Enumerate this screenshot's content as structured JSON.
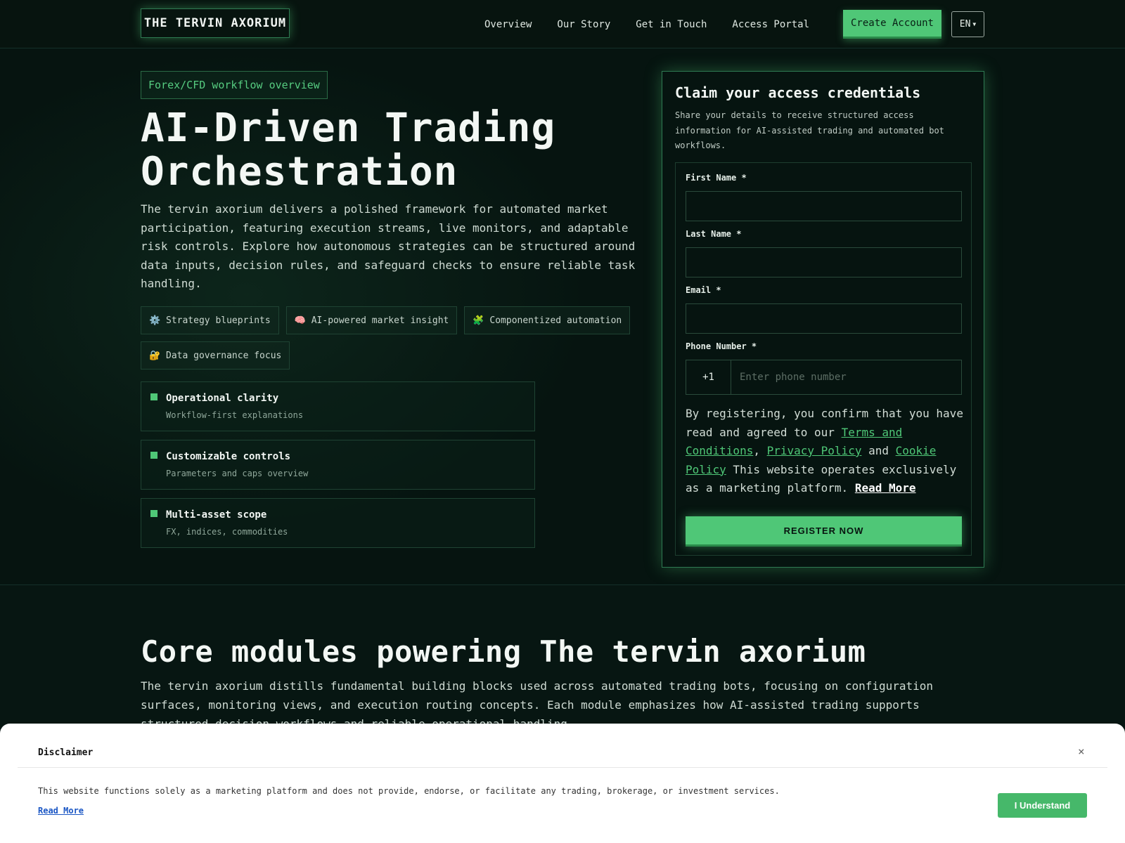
{
  "header": {
    "logo": "THE TERVIN AXORIUM",
    "nav": [
      "Overview",
      "Our Story",
      "Get in Touch",
      "Access Portal"
    ],
    "create_account": "Create Account",
    "language": "EN"
  },
  "hero": {
    "tag": "Forex/CFD workflow overview",
    "title_line1": "AI-Driven Trading",
    "title_line2": "Orchestration",
    "description": "The tervin axorium delivers a polished framework for automated market participation, featuring execution streams, live monitors, and adaptable risk controls. Explore how autonomous strategies can be structured around data inputs, decision rules, and safeguard checks to ensure reliable task handling.",
    "chips": [
      {
        "icon": "gear-icon",
        "glyph": "⚙️",
        "label": "Strategy blueprints"
      },
      {
        "icon": "brain-icon",
        "glyph": "🧠",
        "label": "AI-powered market insight"
      },
      {
        "icon": "puzzle-icon",
        "glyph": "🧩",
        "label": "Componentized automation"
      },
      {
        "icon": "lock-icon",
        "glyph": "🔐",
        "label": "Data governance focus"
      }
    ],
    "features": [
      {
        "title": "Operational clarity",
        "subtitle": "Workflow-first explanations"
      },
      {
        "title": "Customizable controls",
        "subtitle": "Parameters and caps overview"
      },
      {
        "title": "Multi-asset scope",
        "subtitle": "FX, indices, commodities"
      }
    ]
  },
  "form": {
    "title": "Claim your access credentials",
    "subtitle": "Share your details to receive structured access information for AI-assisted trading and automated bot workflows.",
    "first_name_label": "First Name *",
    "last_name_label": "Last Name *",
    "email_label": "Email *",
    "phone_label": "Phone Number *",
    "phone_code": "+1",
    "phone_placeholder": "Enter phone number",
    "consent_prefix": "By registering, you confirm that you have read and agreed to our ",
    "terms": "Terms and Conditions",
    "comma": ", ",
    "privacy": "Privacy Policy",
    "and": " and ",
    "cookie": "Cookie Policy",
    "consent_suffix": " This website operates exclusively as a marketing platform. ",
    "read_more": "Read More",
    "register": "REGISTER NOW"
  },
  "modules": {
    "title": "Core modules powering The tervin axorium",
    "description": "The tervin axorium distills fundamental building blocks used across automated trading bots, focusing on configuration surfaces, monitoring views, and execution routing concepts. Each module emphasizes how AI-assisted trading supports structured decision workflows and reliable operational handling."
  },
  "disclaimer": {
    "title": "Disclaimer",
    "close": "×",
    "text": "This website functions solely as a marketing platform and does not provide, endorse, or facilitate any trading, brokerage, or investment services.",
    "read_more": "Read More",
    "button": "I Understand"
  },
  "colors": {
    "accent": "#4fc777",
    "background": "#061410"
  }
}
